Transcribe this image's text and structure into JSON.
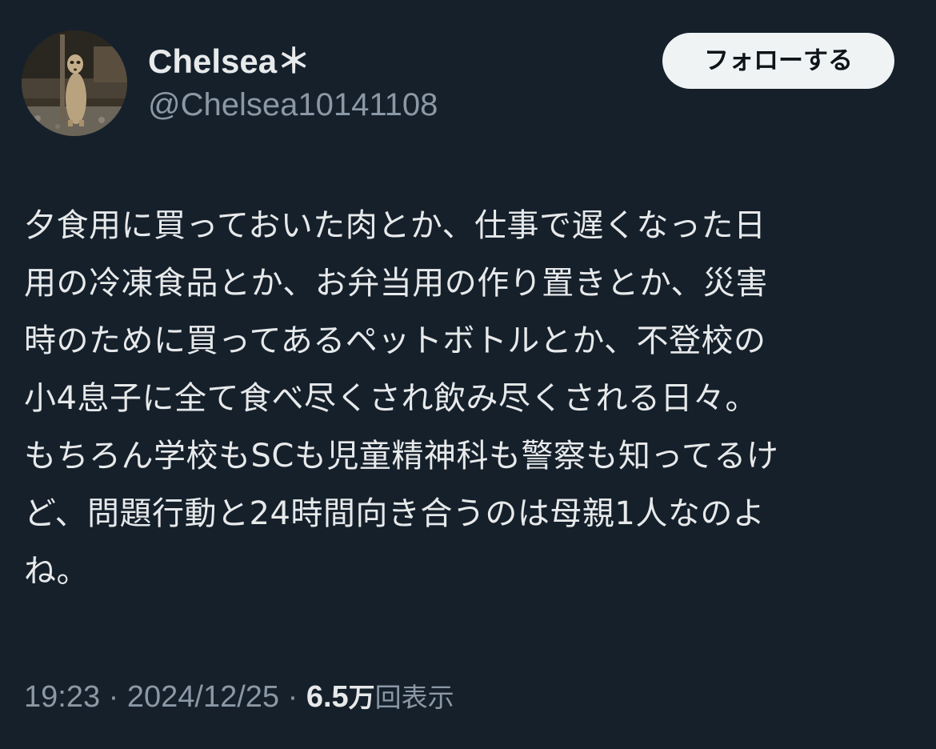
{
  "author": {
    "display_name": "Chelsea＊",
    "handle": "@Chelsea10141108",
    "avatar_icon": "meerkat-photo-avatar"
  },
  "follow_button": {
    "label": "フォローする"
  },
  "tweet": {
    "lines": [
      "夕食用に買っておいた肉とか、仕事で遅くなった日",
      "用の冷凍食品とか、お弁当用の作り置きとか、災害",
      "時のために買ってあるペットボトルとか、不登校の",
      "小4息子に全て食べ尽くされ飲み尽くされる日々。",
      "もちろん学校もSCも児童精神科も警察も知ってるけ",
      "ど、問題行動と24時間向き合うのは母親1人なのよ",
      "ね。"
    ]
  },
  "meta": {
    "time": "19:23",
    "separator": " · ",
    "date": "2024/12/25",
    "views_count": "6.5",
    "views_unit": "万",
    "views_label": "回表示"
  },
  "colors": {
    "background": "#15202b",
    "primary_text": "#e7e9ea",
    "secondary_text": "#8b98a5",
    "button_bg": "#eff3f4",
    "button_text": "#0f1419"
  }
}
